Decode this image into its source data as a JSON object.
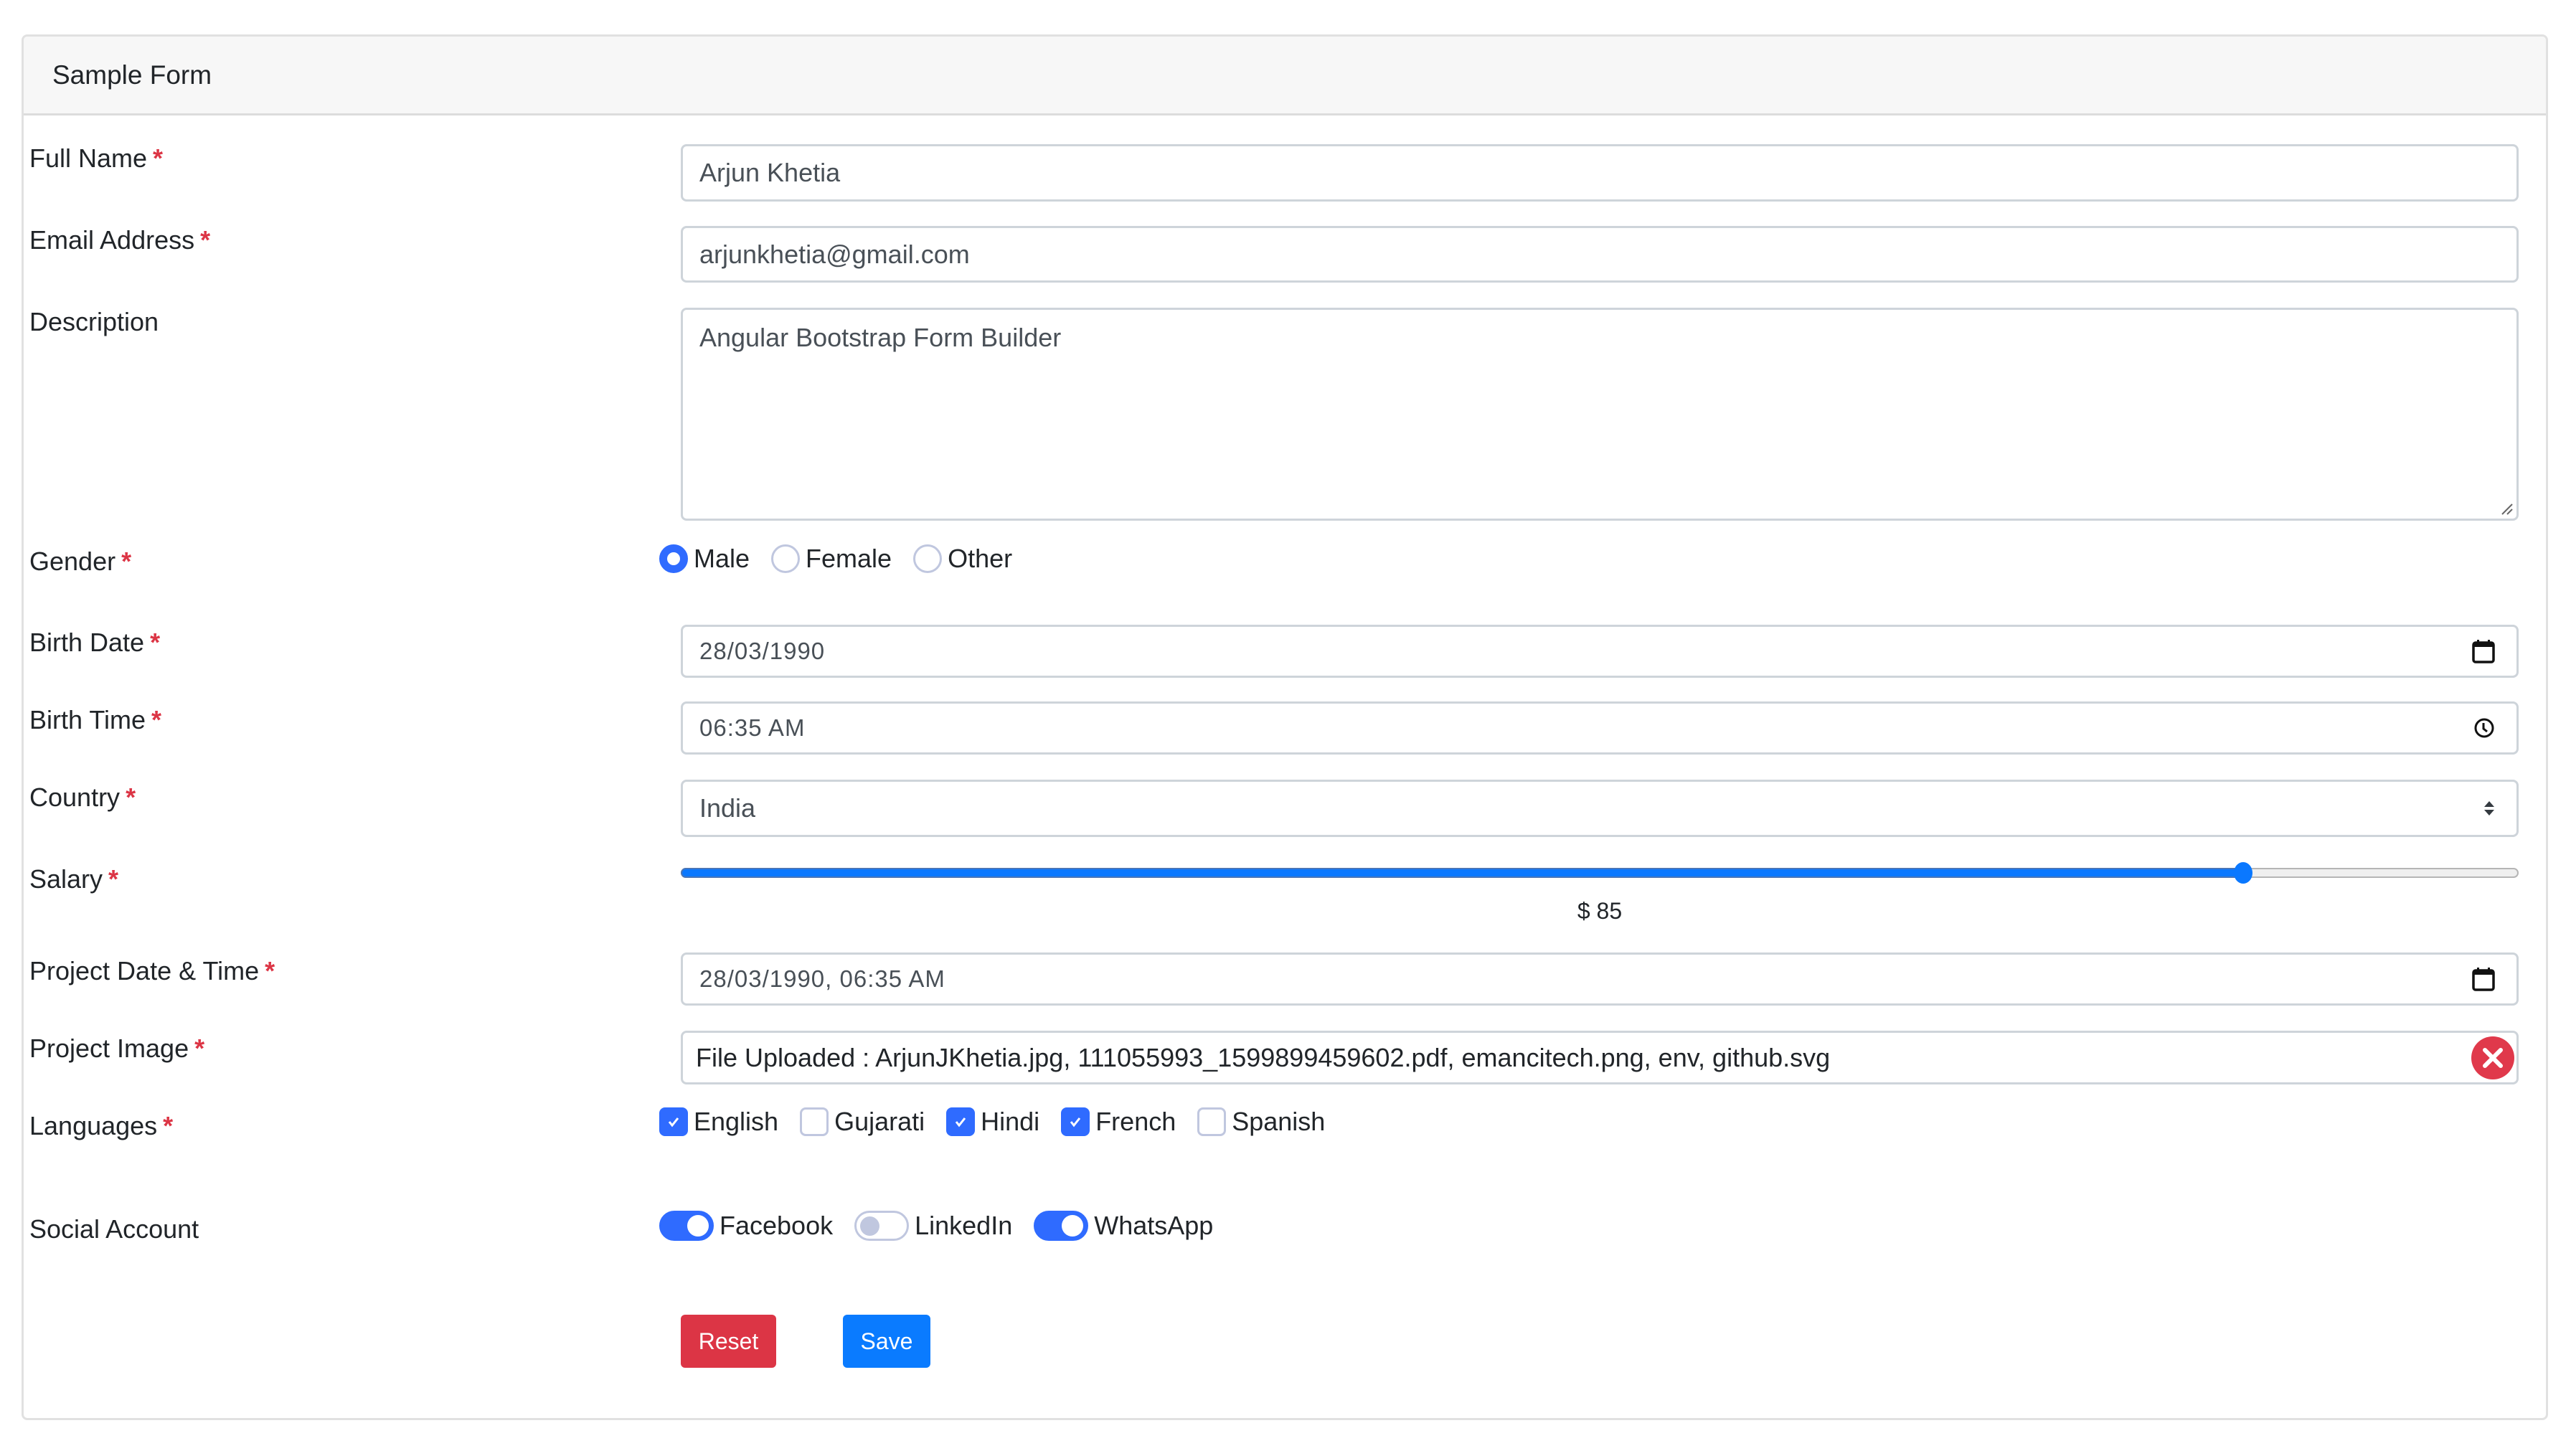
{
  "card": {
    "title": "Sample Form"
  },
  "required_marker": "*",
  "fields": {
    "full_name": {
      "label": "Full Name",
      "value": "Arjun Khetia",
      "required": true
    },
    "email": {
      "label": "Email Address",
      "value": "arjunkhetia@gmail.com",
      "required": true
    },
    "description": {
      "label": "Description",
      "value": "Angular Bootstrap Form Builder",
      "required": false
    },
    "gender": {
      "label": "Gender",
      "required": true,
      "options": [
        {
          "label": "Male",
          "selected": true
        },
        {
          "label": "Female",
          "selected": false
        },
        {
          "label": "Other",
          "selected": false
        }
      ]
    },
    "birth_date": {
      "label": "Birth Date",
      "value": "28/03/1990",
      "required": true,
      "icon": "calendar-icon"
    },
    "birth_time": {
      "label": "Birth Time",
      "value": "06:35 AM",
      "required": true,
      "icon": "clock-icon"
    },
    "country": {
      "label": "Country",
      "value": "India",
      "required": true,
      "icon": "select-arrows-icon"
    },
    "salary": {
      "label": "Salary",
      "required": true,
      "value": 85,
      "min": 0,
      "max": 100,
      "display": "$ 85"
    },
    "project_datetime": {
      "label": "Project Date & Time",
      "value": "28/03/1990, 06:35 AM",
      "required": true,
      "icon": "calendar-icon"
    },
    "project_image": {
      "label": "Project Image",
      "value": "File Uploaded : ArjunJKhetia.jpg, 111055993_1599899459602.pdf, emancitech.png, env, github.svg",
      "required": true,
      "icon": "remove-file-icon"
    },
    "languages": {
      "label": "Languages",
      "required": true,
      "options": [
        {
          "label": "English",
          "checked": true
        },
        {
          "label": "Gujarati",
          "checked": false
        },
        {
          "label": "Hindi",
          "checked": true
        },
        {
          "label": "French",
          "checked": true
        },
        {
          "label": "Spanish",
          "checked": false
        }
      ]
    },
    "social_account": {
      "label": "Social Account",
      "required": false,
      "options": [
        {
          "label": "Facebook",
          "on": true
        },
        {
          "label": "LinkedIn",
          "on": false
        },
        {
          "label": "WhatsApp",
          "on": true
        }
      ]
    }
  },
  "buttons": {
    "reset": "Reset",
    "save": "Save"
  },
  "colors": {
    "primary": "#2f6bff",
    "danger": "#dc3545",
    "save": "#0a7bff",
    "required": "#dc3545"
  }
}
